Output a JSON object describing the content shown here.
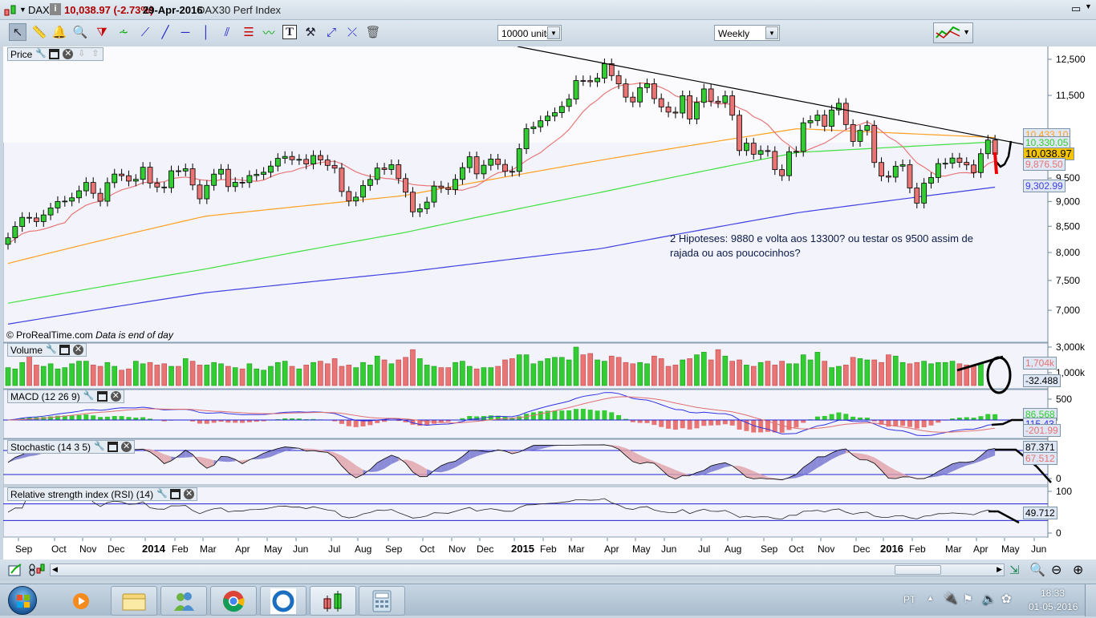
{
  "titlebar": {
    "symbol": "DAX",
    "price_change": "10,038.97 (-2.73%)",
    "date": "29-Apr-2016",
    "name": "DAX30 Perf Index",
    "info_icon": "i"
  },
  "toolbar": {
    "tools": [
      "pointer-icon",
      "ruler-icon",
      "alarm-bell-icon",
      "zoom-icon",
      "triangle-pattern-icon",
      "channel-icon",
      "segment-icon",
      "line-icon",
      "horizontal-line-icon",
      "vertical-line-icon",
      "parallel-lines-icon",
      "fibonacci-icon",
      "trend-line-icon",
      "text-icon",
      "settings-tools-icon",
      "arrow-icon",
      "crossing-line-icon",
      "trash-icon"
    ],
    "units_value": "10000 units",
    "period_value": "Weekly"
  },
  "panels": {
    "price": {
      "label": "Price",
      "copyright": "© ProRealTime.com",
      "note": "Data is end of day",
      "axis": [
        "12,500",
        "11,500",
        "9,500",
        "9,000",
        "8,500",
        "8,000",
        "7,500",
        "7,000"
      ],
      "labels": {
        "orange": "10,433.10",
        "green": "10,330.05",
        "last": "10,038.97",
        "red": "9,876.50",
        "blue": "9,302.99"
      }
    },
    "volume": {
      "label": "Volume",
      "axis": [
        "3,000k",
        "1,000k"
      ],
      "labels": {
        "volume": "1,704k",
        "other": "-32.488"
      }
    },
    "macd": {
      "label": "MACD (12 26 9)",
      "axis": [
        "500"
      ],
      "labels": {
        "hist": "86.568",
        "macd": "115.43",
        "signal": "-201.99"
      }
    },
    "stochastic": {
      "label": "Stochastic (14 3 5)",
      "axis": [
        "0"
      ],
      "labels": {
        "k": "87.371",
        "d": "67.512"
      }
    },
    "rsi": {
      "label": "Relative strength index (RSI) (14)",
      "axis": [
        "100",
        "0"
      ],
      "labels": {
        "rsi": "49.712"
      }
    }
  },
  "annotation": {
    "line1": "2 Hipoteses: 9880 e volta aos 13300? ou testar os 9500 assim de",
    "line2": "rajada ou aos poucocinhos?"
  },
  "x_axis": [
    {
      "t": "Sep"
    },
    {
      "t": "Oct"
    },
    {
      "t": "Nov"
    },
    {
      "t": "Dec"
    },
    {
      "t": "2014",
      "b": true
    },
    {
      "t": "Feb"
    },
    {
      "t": "Mar"
    },
    {
      "t": "Apr"
    },
    {
      "t": "May"
    },
    {
      "t": "Jun"
    },
    {
      "t": "Jul"
    },
    {
      "t": "Aug"
    },
    {
      "t": "Sep"
    },
    {
      "t": "Oct"
    },
    {
      "t": "Nov"
    },
    {
      "t": "Dec"
    },
    {
      "t": "2015",
      "b": true
    },
    {
      "t": "Feb"
    },
    {
      "t": "Mar"
    },
    {
      "t": "Apr"
    },
    {
      "t": "May"
    },
    {
      "t": "Jun"
    },
    {
      "t": "Jul"
    },
    {
      "t": "Aug"
    },
    {
      "t": "Sep"
    },
    {
      "t": "Oct"
    },
    {
      "t": "Nov"
    },
    {
      "t": "Dec"
    },
    {
      "t": "2016",
      "b": true
    },
    {
      "t": "Feb"
    },
    {
      "t": "Mar"
    },
    {
      "t": "Apr"
    },
    {
      "t": "May"
    },
    {
      "t": "Jun"
    }
  ],
  "colors": {
    "up": "#33cc33",
    "down": "#e87474",
    "ma_red": "#e87878",
    "ma_orange": "#ffa020",
    "ma_green": "#40e040",
    "ma_blue": "#4040e0",
    "last_bg": "#f5c400",
    "bg": "#f2f3fb"
  },
  "chart_data": {
    "type": "candlestick",
    "scale": "log",
    "ylim": [
      6700,
      12700
    ],
    "period": "weekly",
    "first_week": "Sep 2013",
    "last_week": "29-Apr-2016",
    "closes": [
      8276,
      8495,
      8676,
      8665,
      8592,
      8725,
      8867,
      9001,
      9009,
      9077,
      9225,
      9405,
      9172,
      9006,
      9400,
      9589,
      9552,
      9435,
      9473,
      9742,
      9392,
      9306,
      9291,
      9662,
      9657,
      9708,
      9350,
      9056,
      9342,
      9588,
      9695,
      9315,
      9409,
      9402,
      9556,
      9581,
      9629,
      9768,
      9943,
      9987,
      9912,
      9920,
      9815,
      10009,
      9906,
      9783,
      9721,
      9210,
      9010,
      9092,
      9340,
      9470,
      9724,
      9691,
      9799,
      9490,
      9196,
      8788,
      8850,
      8988,
      9326,
      9291,
      9252,
      9472,
      9733,
      9980,
      9594,
      9787,
      9927,
      9805,
      9649,
      9648,
      10167,
      10649,
      10694,
      10846,
      10963,
      11050,
      11210,
      11401,
      11901,
      11899,
      11868,
      11968,
      12375,
      12039,
      11811,
      11454,
      11327,
      11709,
      11815,
      11414,
      11197,
      11065,
      11041,
      11492,
      10890,
      11316,
      11673,
      11347,
      11308,
      11490,
      10985,
      10124,
      10298,
      10038,
      10123,
      10104,
      9688,
      9553,
      10096,
      10104,
      10795,
      10850,
      10988,
      10708,
      11119,
      11293,
      10752,
      10340,
      10608,
      10727,
      9849,
      9545,
      9521,
      9765,
      9798,
      9286,
      8967,
      9388,
      9513,
      9824,
      9831,
      9950,
      9851,
      9794,
      9622,
      10051,
      10373,
      10039
    ],
    "volume_k": [
      1400,
      1300,
      1800,
      2500,
      1600,
      1500,
      1700,
      1300,
      1400,
      1700,
      1900,
      1900,
      1600,
      1500,
      1800,
      1500,
      1200,
      1300,
      1900,
      1700,
      1800,
      1600,
      1700,
      1500,
      1500,
      2100,
      1900,
      1600,
      1600,
      1800,
      1700,
      1500,
      1400,
      1300,
      1700,
      1300,
      1200,
      1500,
      1800,
      1900,
      1500,
      1300,
      1600,
      1800,
      1900,
      1700,
      2100,
      1500,
      1600,
      1400,
      1800,
      1600,
      2300,
      2000,
      1700,
      2000,
      2200,
      2800,
      2100,
      1600,
      1500,
      1400,
      1400,
      1800,
      1900,
      1500,
      1300,
      1400,
      1400,
      1500,
      2000,
      2100,
      2400,
      2400,
      1700,
      1900,
      2100,
      2200,
      2200,
      2000,
      3000,
      2400,
      2500,
      2000,
      1900,
      2300,
      2200,
      1800,
      1700,
      1800,
      1700,
      2300,
      2100,
      1500,
      1600,
      2000,
      2100,
      2400,
      2600,
      2000,
      2800,
      2300,
      1900,
      2000,
      1600,
      1500,
      1800,
      1900,
      1600,
      1900,
      1700,
      1700,
      2400,
      2000,
      2600,
      1900,
      1400,
      1500,
      1600,
      2200,
      2100,
      2000,
      2000,
      1800,
      2400,
      2300,
      1800,
      1700,
      1800,
      1900,
      1700,
      1800,
      1800,
      1900,
      1700,
      1600,
      1500,
      1704
    ],
    "moving_averages": {
      "orange": [
        7800,
        8700,
        9120,
        9900,
        10650,
        10433.1
      ],
      "green": [
        7115,
        7700,
        8370,
        9190,
        10080,
        10330.05
      ],
      "blue": [
        6780,
        7290,
        7640,
        8070,
        8770,
        9302.99
      ]
    }
  },
  "scrollbar": {},
  "taskbar": {
    "lang": "PT",
    "time": "18:33",
    "date": "01-05-2016"
  }
}
